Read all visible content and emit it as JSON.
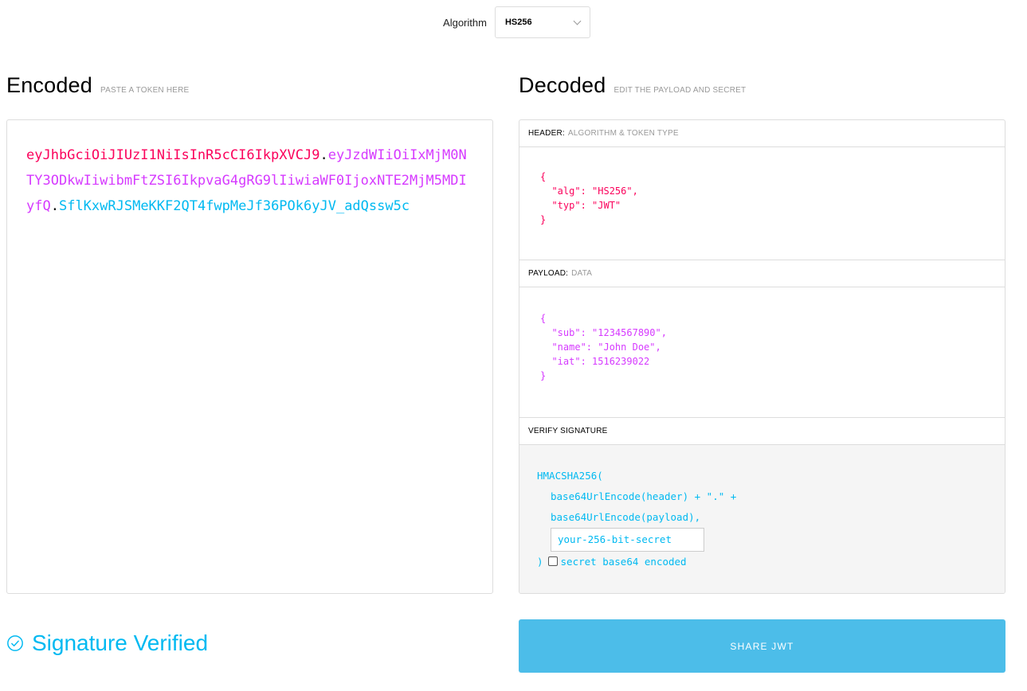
{
  "algorithm": {
    "label": "Algorithm",
    "selected": "HS256"
  },
  "encoded": {
    "title": "Encoded",
    "subtitle": "PASTE A TOKEN HERE",
    "token_header": "eyJhbGciOiJIUzI1NiIsInR5cCI6IkpXVCJ9",
    "token_payload": "eyJzdWIiOiIxMjM0NTY3ODkwIiwibmFtZSI6IkpvaG4gRG9lIiwiaWF0IjoxNTE2MjM5MDIyfQ",
    "token_signature": "SflKxwRJSMeKKF2QT4fwpMeJf36POk6yJV_adQssw5c",
    "dot": "."
  },
  "decoded": {
    "title": "Decoded",
    "subtitle": "EDIT THE PAYLOAD AND SECRET",
    "header_section": {
      "title": "HEADER:",
      "sub": "ALGORITHM & TOKEN TYPE",
      "lines": [
        "{",
        "  \"alg\": \"HS256\",",
        "  \"typ\": \"JWT\"",
        "}"
      ]
    },
    "payload_section": {
      "title": "PAYLOAD:",
      "sub": "DATA",
      "lines": [
        "{",
        "  \"sub\": \"1234567890\",",
        "  \"name\": \"John Doe\",",
        "  \"iat\": 1516239022",
        "}"
      ]
    },
    "signature_section": {
      "title": "VERIFY SIGNATURE",
      "fn_open": "HMACSHA256(",
      "line1": "base64UrlEncode(header) + \".\" +",
      "line2": "base64UrlEncode(payload),",
      "secret_value": "your-256-bit-secret",
      "close": ")",
      "checkbox_label": "secret base64 encoded"
    }
  },
  "status": {
    "text": "Signature Verified",
    "icon": "check-circle-icon"
  },
  "share_button": {
    "label": "SHARE JWT"
  },
  "colors": {
    "header": "#fb015b",
    "payload": "#d63aff",
    "signature": "#00b9f1",
    "share_bg": "#4cbde9"
  }
}
